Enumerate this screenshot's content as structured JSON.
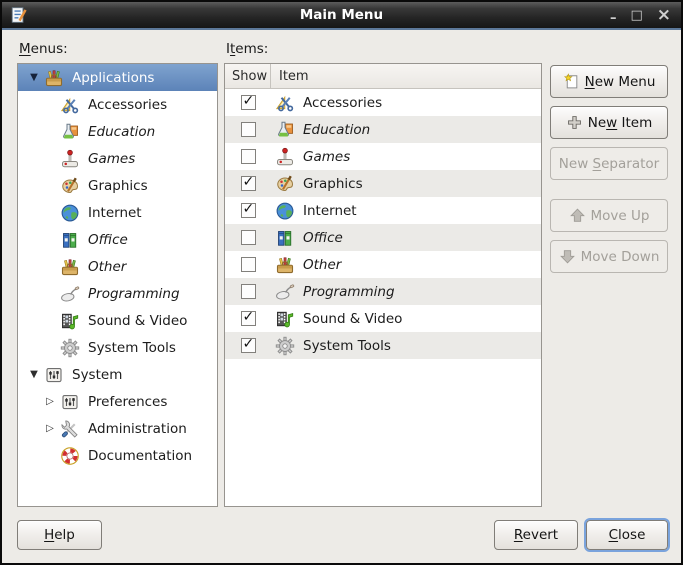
{
  "window": {
    "title": "Main Menu",
    "icon": "app-logo"
  },
  "icons": {
    "minimize": "–",
    "maximize": "□",
    "close": "×",
    "expander_expanded": "▼",
    "expander_collapsed": "▷",
    "check_mark": "✓"
  },
  "labels": {
    "menus": {
      "pre": "",
      "key": "M",
      "post": "enus:"
    },
    "items": {
      "pre": "I",
      "key": "t",
      "post": "ems:"
    }
  },
  "tree": {
    "items": [
      {
        "label": "Applications",
        "icon": "toolbox",
        "selected": true,
        "expanded": true
      },
      {
        "label": "Accessories",
        "icon": "accessories",
        "indented": true
      },
      {
        "label": "Education",
        "icon": "education",
        "indented": true,
        "italic": true
      },
      {
        "label": "Games",
        "icon": "games",
        "indented": true,
        "italic": true
      },
      {
        "label": "Graphics",
        "icon": "graphics",
        "indented": true
      },
      {
        "label": "Internet",
        "icon": "internet",
        "indented": true
      },
      {
        "label": "Office",
        "icon": "office",
        "indented": true,
        "italic": true
      },
      {
        "label": "Other",
        "icon": "toolbox",
        "indented": true,
        "italic": true
      },
      {
        "label": "Programming",
        "icon": "programming",
        "indented": true,
        "italic": true
      },
      {
        "label": "Sound & Video",
        "icon": "sound-video",
        "indented": true
      },
      {
        "label": "System Tools",
        "icon": "system-tools",
        "indented": true
      },
      {
        "label": "System",
        "icon": "prefs",
        "expanded": true
      },
      {
        "label": "Preferences",
        "icon": "prefs",
        "indented": true,
        "collapsed": true
      },
      {
        "label": "Administration",
        "icon": "admin",
        "indented": true,
        "collapsed": true
      },
      {
        "label": "Documentation",
        "icon": "docs",
        "indented": true
      }
    ]
  },
  "items_table": {
    "columns": [
      "Show",
      "Item"
    ],
    "rows": [
      {
        "label": "Accessories",
        "icon": "accessories",
        "checked": true
      },
      {
        "label": "Education",
        "icon": "education",
        "checked": false,
        "italic": true
      },
      {
        "label": "Games",
        "icon": "games",
        "checked": false,
        "italic": true
      },
      {
        "label": "Graphics",
        "icon": "graphics",
        "checked": true
      },
      {
        "label": "Internet",
        "icon": "internet",
        "checked": true
      },
      {
        "label": "Office",
        "icon": "office",
        "checked": false,
        "italic": true
      },
      {
        "label": "Other",
        "icon": "toolbox",
        "checked": false,
        "italic": true
      },
      {
        "label": "Programming",
        "icon": "programming",
        "checked": false,
        "italic": true
      },
      {
        "label": "Sound & Video",
        "icon": "sound-video",
        "checked": true
      },
      {
        "label": "System Tools",
        "icon": "system-tools",
        "checked": true
      }
    ]
  },
  "actions": {
    "new_menu": {
      "pre": "",
      "key": "N",
      "post": "ew Menu",
      "icon": "new-doc",
      "disabled": false
    },
    "new_item": {
      "pre": "Ne",
      "key": "w",
      "post": " Item",
      "icon": "plus",
      "disabled": false
    },
    "new_separator": {
      "pre": "New ",
      "key": "S",
      "post": "eparator",
      "icon": "blank",
      "no_icon": true,
      "disabled": true
    },
    "move_up": {
      "pre": "Move Up",
      "key": "",
      "post": "",
      "icon": "arrow-up",
      "disabled": true
    },
    "move_down": {
      "pre": "Move Down",
      "key": "",
      "post": "",
      "icon": "arrow-down",
      "disabled": true
    }
  },
  "footer": {
    "help": {
      "pre": "",
      "key": "H",
      "post": "elp"
    },
    "revert": {
      "pre": "",
      "key": "R",
      "post": "evert"
    },
    "close": {
      "pre": "",
      "key": "C",
      "post": "lose"
    }
  },
  "selection_color": "#5c83b8",
  "titlebar_color": "#252525"
}
